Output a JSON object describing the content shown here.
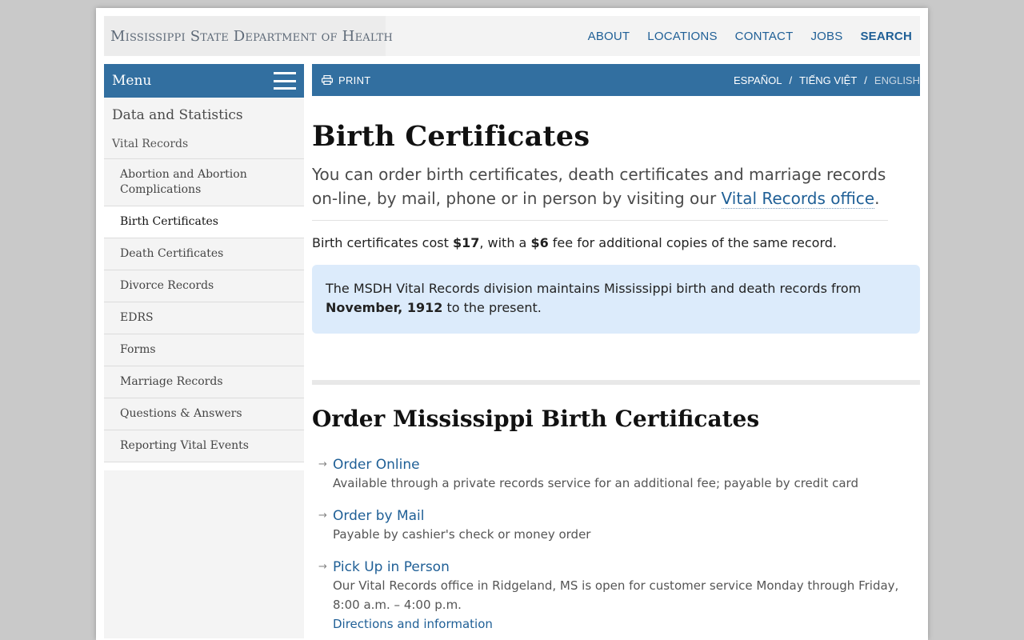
{
  "header": {
    "logo_text": "Mississippi State Department of Health",
    "nav": [
      {
        "label": "ABOUT"
      },
      {
        "label": "LOCATIONS"
      },
      {
        "label": "CONTACT"
      },
      {
        "label": "JOBS"
      },
      {
        "label": "SEARCH"
      }
    ]
  },
  "sidebar": {
    "menu_label": "Menu",
    "section_heading": "Data and Statistics",
    "subsection": "Vital Records",
    "items": [
      {
        "label": "Abortion and Abortion Complications"
      },
      {
        "label": "Birth Certificates"
      },
      {
        "label": "Death Certificates"
      },
      {
        "label": "Divorce Records"
      },
      {
        "label": "EDRS"
      },
      {
        "label": "Forms"
      },
      {
        "label": "Marriage Records"
      },
      {
        "label": "Questions & Answers"
      },
      {
        "label": "Reporting Vital Events"
      }
    ]
  },
  "toolbar": {
    "print_label": "PRINT",
    "languages": [
      "ESPAÑOL",
      "TIẾNG VIỆT",
      "ENGLISH"
    ],
    "separator": "/"
  },
  "content": {
    "title": "Birth Certificates",
    "lead_before": "You can order birth certificates, death certificates and marriage records on-line, by mail, phone or in person by visiting our ",
    "lead_link": "Vital Records office",
    "lead_after": ".",
    "cost_1": "Birth certificates cost ",
    "cost_price": "$17",
    "cost_2": ", with a ",
    "cost_fee": "$6",
    "cost_3": " fee for additional copies of the same record.",
    "callout_1": "The MSDH Vital Records division maintains Mississippi birth and death records from ",
    "callout_date": "November, 1912",
    "callout_2": " to the present.",
    "order_title": "Order Mississippi Birth Certificates",
    "options": [
      {
        "title": "Order Online",
        "desc": "Available through a private records service for an additional fee; payable by credit card"
      },
      {
        "title": "Order by Mail",
        "desc": "Payable by cashier's check or money order"
      },
      {
        "title": "Pick Up in Person",
        "desc": "Our Vital Records office in Ridgeland, MS is open for customer service Monday through Friday, 8:00 a.m. – 4:00 p.m.",
        "sublink": "Directions and information"
      }
    ]
  }
}
